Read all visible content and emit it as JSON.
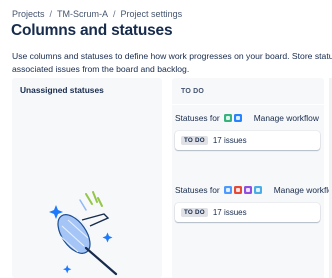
{
  "breadcrumb": {
    "items": [
      "Projects",
      "TM-Scrum-A",
      "Project settings"
    ],
    "separator": "/"
  },
  "page": {
    "title": "Columns and statuses",
    "description_lines": [
      "Use columns and statuses to define how work progresses on your board. Store statuses in",
      "associated issues from the board and backlog."
    ]
  },
  "unassigned": {
    "title": "Unassigned statuses"
  },
  "column": {
    "header": "TO DO",
    "groups": [
      {
        "prefix": "Statuses for",
        "type_icons": [
          {
            "name": "story-icon",
            "color": "#36b37e"
          },
          {
            "name": "task-icon",
            "color": "#2684ff"
          }
        ],
        "manage_label": "Manage workflow",
        "status_lozenge": "TO DO",
        "issue_count": "17 issues"
      },
      {
        "prefix": "Statuses for",
        "type_icons": [
          {
            "name": "subtask-icon",
            "color": "#4c9aff"
          },
          {
            "name": "bug-icon",
            "color": "#e5493a"
          },
          {
            "name": "epic-icon",
            "color": "#904ee2"
          },
          {
            "name": "task-icon",
            "color": "#4bade8"
          }
        ],
        "manage_label": "Manage workflo",
        "status_lozenge": "TO DO",
        "issue_count": "17 issues"
      }
    ]
  }
}
